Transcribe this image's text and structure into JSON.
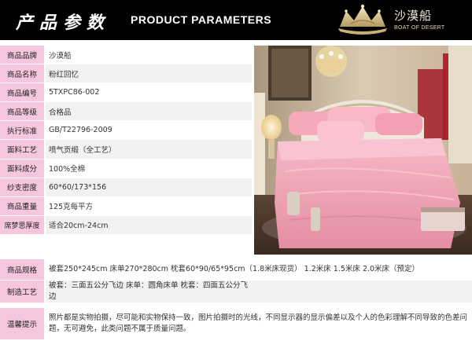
{
  "header": {
    "title_cn": "产品参数",
    "title_en": "PRODUCT PARAMETERS",
    "brand_cn": "沙漠船",
    "brand_en": "BOAT OF DESERT"
  },
  "params": [
    {
      "label": "商品品牌",
      "value": "沙漠船"
    },
    {
      "label": "商品名称",
      "value": "粉红回忆"
    },
    {
      "label": "商品编号",
      "value": "5TXPC86-002"
    },
    {
      "label": "商品等级",
      "value": "合格品"
    },
    {
      "label": "执行标准",
      "value": "GB/T22796-2009"
    },
    {
      "label": "面料工艺",
      "value": "喷气贡缎（全工艺）"
    },
    {
      "label": "面料成分",
      "value": "100%全棉"
    },
    {
      "label": "纱支密度",
      "value": "60*60/173*156"
    },
    {
      "label": "商品重量",
      "value": "125克每平方"
    },
    {
      "label": "席梦思厚度",
      "value": "适合20cm-24cm"
    }
  ],
  "spec": {
    "label": "商品规格",
    "value": "被套250*245cm 床单270*280cm  枕套60*90/65*95cm（1.8米床现货）  1.2米床  1.5米床  2.0米床（预定）"
  },
  "craft": {
    "label": "制造工艺",
    "value": "被套：三面五公分飞边   床单：圆角床单   枕套：四面五公分飞边"
  },
  "notice": {
    "label": "温馨提示",
    "value": "照片都是实物拍摄，尽可能和实物保持一致，图片拍摄时的光线，不同显示器的显示偏差以及个人的色彩理解不同导致的色差问题，无可避免，此类问题不属于质量问题。"
  },
  "colors": {
    "label_bg": "#f5c6dd",
    "header_bg": "#000000",
    "bedding_pink": "#f2a3b6"
  }
}
